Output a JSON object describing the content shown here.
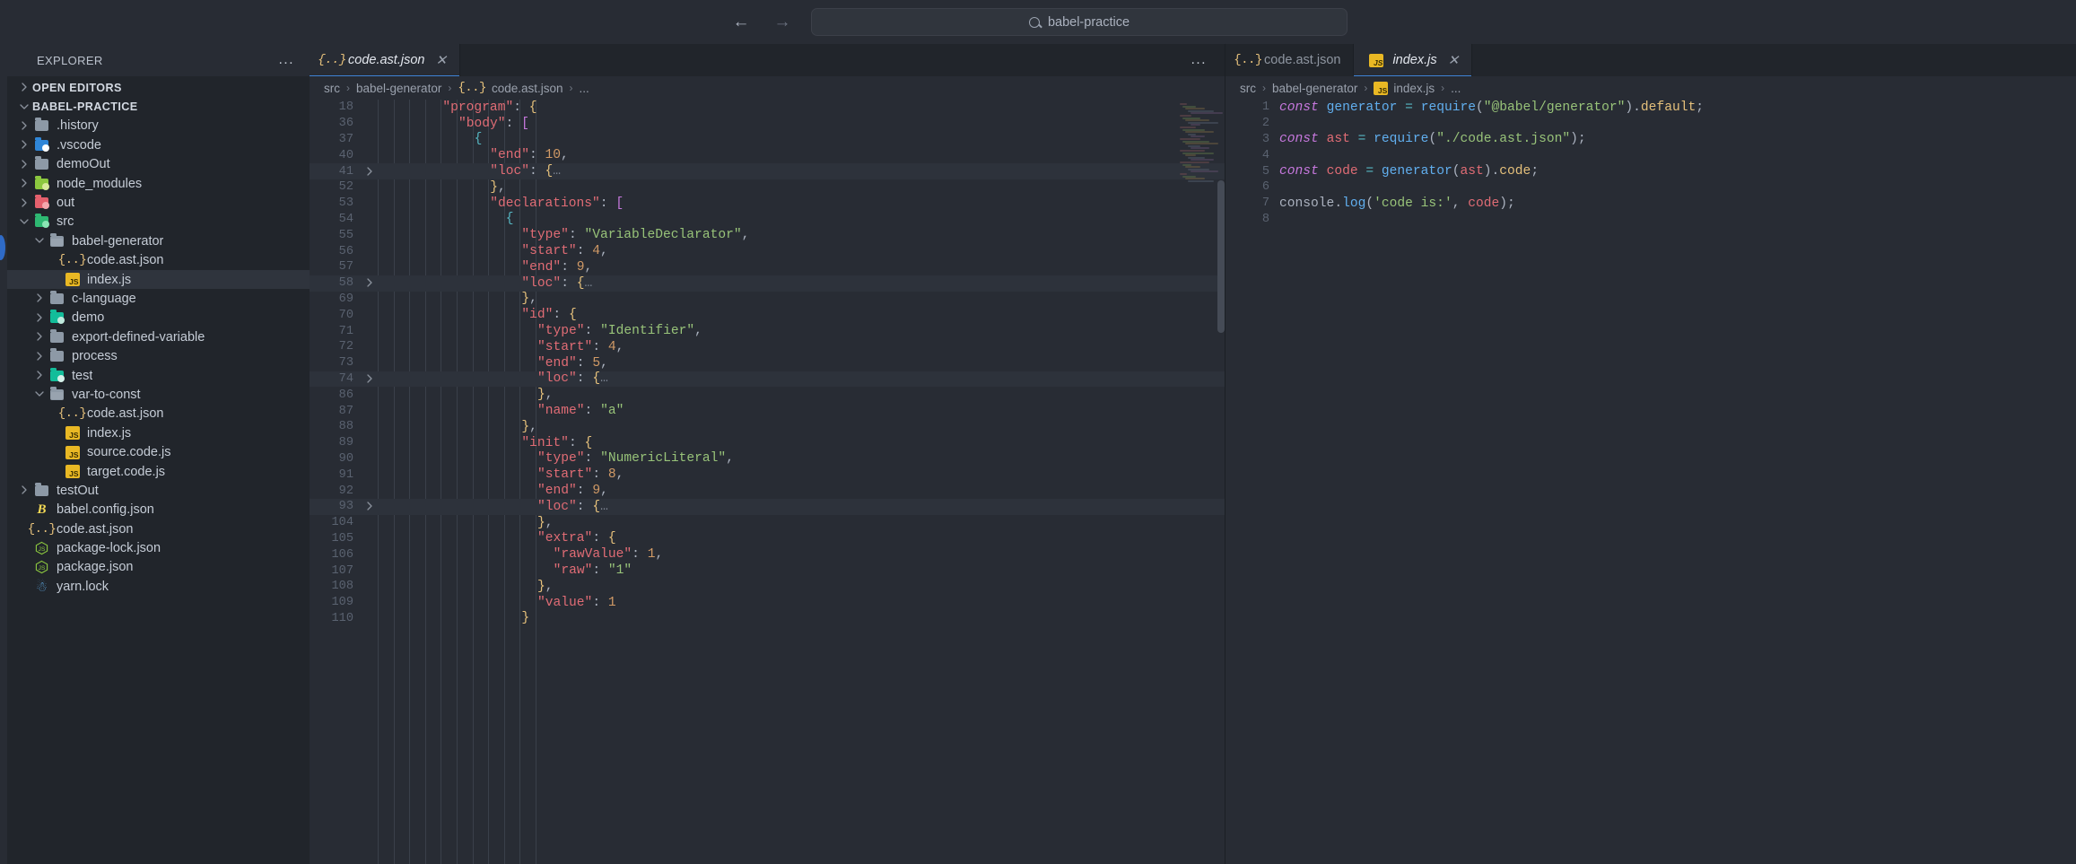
{
  "titlebar": {
    "back_icon": "arrow-left-icon",
    "forward_icon": "arrow-right-icon",
    "search_icon": "search-icon",
    "search_value": "babel-practice"
  },
  "sidebar": {
    "title": "EXPLORER",
    "more_label": "...",
    "sections": [
      {
        "label": "OPEN EDITORS",
        "expanded": false
      },
      {
        "label": "BABEL-PRACTICE",
        "expanded": true
      }
    ],
    "items": [
      {
        "label": ".history",
        "depth": 1,
        "type": "folder",
        "arrow": "collapsed",
        "color": "#8d99a6"
      },
      {
        "label": ".vscode",
        "depth": 1,
        "type": "folder",
        "arrow": "collapsed",
        "color": "#2f86d8",
        "badge": "#ffffff"
      },
      {
        "label": "demoOut",
        "depth": 1,
        "type": "folder",
        "arrow": "collapsed",
        "color": "#8d99a6"
      },
      {
        "label": "node_modules",
        "depth": 1,
        "type": "folder",
        "arrow": "collapsed",
        "color": "#8cc83f",
        "badge": "#d7ea9a"
      },
      {
        "label": "out",
        "depth": 1,
        "type": "folder",
        "arrow": "collapsed",
        "color": "#e4606d",
        "badge": "#f4a7ad"
      },
      {
        "label": "src",
        "depth": 1,
        "type": "folder",
        "arrow": "expanded",
        "color": "#2eb872",
        "badge": "#8ae6b4"
      },
      {
        "label": "babel-generator",
        "depth": 2,
        "type": "folderopen",
        "arrow": "expanded",
        "color": "#8d99a6"
      },
      {
        "label": "code.ast.json",
        "depth": 3,
        "type": "json",
        "arrow": "none"
      },
      {
        "label": "index.js",
        "depth": 3,
        "type": "js",
        "arrow": "none",
        "selected": true
      },
      {
        "label": "c-language",
        "depth": 2,
        "type": "folder",
        "arrow": "collapsed",
        "color": "#8d99a6"
      },
      {
        "label": "demo",
        "depth": 2,
        "type": "folder",
        "arrow": "collapsed",
        "color": "#13bd9a",
        "badge": "#bfe9dd"
      },
      {
        "label": "export-defined-variable",
        "depth": 2,
        "type": "folder",
        "arrow": "collapsed",
        "color": "#8d99a6"
      },
      {
        "label": "process",
        "depth": 2,
        "type": "folder",
        "arrow": "collapsed",
        "color": "#8d99a6"
      },
      {
        "label": "test",
        "depth": 2,
        "type": "folder",
        "arrow": "collapsed",
        "color": "#13bd9a",
        "badge": "#d6f2ea"
      },
      {
        "label": "var-to-const",
        "depth": 2,
        "type": "folderopen",
        "arrow": "expanded",
        "color": "#8d99a6"
      },
      {
        "label": "code.ast.json",
        "depth": 3,
        "type": "json",
        "arrow": "none"
      },
      {
        "label": "index.js",
        "depth": 3,
        "type": "js",
        "arrow": "none"
      },
      {
        "label": "source.code.js",
        "depth": 3,
        "type": "js",
        "arrow": "none"
      },
      {
        "label": "target.code.js",
        "depth": 3,
        "type": "js",
        "arrow": "none"
      },
      {
        "label": "testOut",
        "depth": 1,
        "type": "folder",
        "arrow": "collapsed",
        "color": "#8d99a6"
      },
      {
        "label": "babel.config.json",
        "depth": 1,
        "type": "babel",
        "arrow": "none"
      },
      {
        "label": "code.ast.json",
        "depth": 1,
        "type": "json",
        "arrow": "none"
      },
      {
        "label": "package-lock.json",
        "depth": 1,
        "type": "node",
        "arrow": "none"
      },
      {
        "label": "package.json",
        "depth": 1,
        "type": "node",
        "arrow": "none"
      },
      {
        "label": "yarn.lock",
        "depth": 1,
        "type": "yarn",
        "arrow": "none"
      }
    ]
  },
  "left_group": {
    "more_label": "...",
    "tabs": [
      {
        "label": "code.ast.json",
        "icon": "json-icon",
        "active": true,
        "close_icon": "close-icon"
      }
    ],
    "breadcrumb": [
      "src",
      "babel-generator",
      "code.ast.json",
      "..."
    ],
    "lines": [
      {
        "n": "18",
        "fold": "",
        "indent": 4,
        "tokens": [
          {
            "t": "key",
            "v": "\"program\""
          },
          {
            "t": "punc",
            "v": ": "
          },
          {
            "t": "brace",
            "v": "{"
          }
        ]
      },
      {
        "n": "36",
        "fold": "",
        "indent": 5,
        "tokens": [
          {
            "t": "key",
            "v": "\"body\""
          },
          {
            "t": "punc",
            "v": ": "
          },
          {
            "t": "brack",
            "v": "["
          }
        ]
      },
      {
        "n": "37",
        "fold": "",
        "indent": 6,
        "tokens": [
          {
            "t": "cy",
            "v": "{"
          }
        ]
      },
      {
        "n": "40",
        "fold": "",
        "indent": 7,
        "tokens": [
          {
            "t": "key",
            "v": "\"end\""
          },
          {
            "t": "punc",
            "v": ": "
          },
          {
            "t": "num",
            "v": "10"
          },
          {
            "t": "punc",
            "v": ","
          }
        ]
      },
      {
        "n": "41",
        "fold": ">",
        "hl": true,
        "indent": 7,
        "tokens": [
          {
            "t": "key",
            "v": "\"loc\""
          },
          {
            "t": "punc",
            "v": ": "
          },
          {
            "t": "brace",
            "v": "{"
          },
          {
            "t": "fold",
            "v": "…"
          }
        ]
      },
      {
        "n": "52",
        "fold": "",
        "indent": 7,
        "tokens": [
          {
            "t": "brace",
            "v": "}"
          },
          {
            "t": "punc",
            "v": ","
          }
        ]
      },
      {
        "n": "53",
        "fold": "",
        "indent": 7,
        "tokens": [
          {
            "t": "key",
            "v": "\"declarations\""
          },
          {
            "t": "punc",
            "v": ": "
          },
          {
            "t": "brack",
            "v": "["
          }
        ]
      },
      {
        "n": "54",
        "fold": "",
        "indent": 8,
        "tokens": [
          {
            "t": "cy",
            "v": "{"
          }
        ]
      },
      {
        "n": "55",
        "fold": "",
        "indent": 9,
        "tokens": [
          {
            "t": "key",
            "v": "\"type\""
          },
          {
            "t": "punc",
            "v": ": "
          },
          {
            "t": "str",
            "v": "\"VariableDeclarator\""
          },
          {
            "t": "punc",
            "v": ","
          }
        ]
      },
      {
        "n": "56",
        "fold": "",
        "indent": 9,
        "tokens": [
          {
            "t": "key",
            "v": "\"start\""
          },
          {
            "t": "punc",
            "v": ": "
          },
          {
            "t": "num",
            "v": "4"
          },
          {
            "t": "punc",
            "v": ","
          }
        ]
      },
      {
        "n": "57",
        "fold": "",
        "indent": 9,
        "tokens": [
          {
            "t": "key",
            "v": "\"end\""
          },
          {
            "t": "punc",
            "v": ": "
          },
          {
            "t": "num",
            "v": "9"
          },
          {
            "t": "punc",
            "v": ","
          }
        ]
      },
      {
        "n": "58",
        "fold": ">",
        "hl": true,
        "indent": 9,
        "tokens": [
          {
            "t": "key",
            "v": "\"loc\""
          },
          {
            "t": "punc",
            "v": ": "
          },
          {
            "t": "brace",
            "v": "{"
          },
          {
            "t": "fold",
            "v": "…"
          }
        ]
      },
      {
        "n": "69",
        "fold": "",
        "indent": 9,
        "tokens": [
          {
            "t": "brace",
            "v": "}"
          },
          {
            "t": "punc",
            "v": ","
          }
        ]
      },
      {
        "n": "70",
        "fold": "",
        "indent": 9,
        "tokens": [
          {
            "t": "key",
            "v": "\"id\""
          },
          {
            "t": "punc",
            "v": ": "
          },
          {
            "t": "brace",
            "v": "{"
          }
        ]
      },
      {
        "n": "71",
        "fold": "",
        "indent": 10,
        "tokens": [
          {
            "t": "key",
            "v": "\"type\""
          },
          {
            "t": "punc",
            "v": ": "
          },
          {
            "t": "str",
            "v": "\"Identifier\""
          },
          {
            "t": "punc",
            "v": ","
          }
        ]
      },
      {
        "n": "72",
        "fold": "",
        "indent": 10,
        "tokens": [
          {
            "t": "key",
            "v": "\"start\""
          },
          {
            "t": "punc",
            "v": ": "
          },
          {
            "t": "num",
            "v": "4"
          },
          {
            "t": "punc",
            "v": ","
          }
        ]
      },
      {
        "n": "73",
        "fold": "",
        "indent": 10,
        "tokens": [
          {
            "t": "key",
            "v": "\"end\""
          },
          {
            "t": "punc",
            "v": ": "
          },
          {
            "t": "num",
            "v": "5"
          },
          {
            "t": "punc",
            "v": ","
          }
        ]
      },
      {
        "n": "74",
        "fold": ">",
        "hl": true,
        "indent": 10,
        "tokens": [
          {
            "t": "key",
            "v": "\"loc\""
          },
          {
            "t": "punc",
            "v": ": "
          },
          {
            "t": "brace",
            "v": "{"
          },
          {
            "t": "fold",
            "v": "…"
          }
        ]
      },
      {
        "n": "86",
        "fold": "",
        "indent": 10,
        "tokens": [
          {
            "t": "brace",
            "v": "}"
          },
          {
            "t": "punc",
            "v": ","
          }
        ]
      },
      {
        "n": "87",
        "fold": "",
        "indent": 10,
        "tokens": [
          {
            "t": "key",
            "v": "\"name\""
          },
          {
            "t": "punc",
            "v": ": "
          },
          {
            "t": "str",
            "v": "\"a\""
          }
        ]
      },
      {
        "n": "88",
        "fold": "",
        "indent": 9,
        "tokens": [
          {
            "t": "brace",
            "v": "}"
          },
          {
            "t": "punc",
            "v": ","
          }
        ]
      },
      {
        "n": "89",
        "fold": "",
        "indent": 9,
        "tokens": [
          {
            "t": "key",
            "v": "\"init\""
          },
          {
            "t": "punc",
            "v": ": "
          },
          {
            "t": "brace",
            "v": "{"
          }
        ]
      },
      {
        "n": "90",
        "fold": "",
        "indent": 10,
        "tokens": [
          {
            "t": "key",
            "v": "\"type\""
          },
          {
            "t": "punc",
            "v": ": "
          },
          {
            "t": "str",
            "v": "\"NumericLiteral\""
          },
          {
            "t": "punc",
            "v": ","
          }
        ]
      },
      {
        "n": "91",
        "fold": "",
        "indent": 10,
        "tokens": [
          {
            "t": "key",
            "v": "\"start\""
          },
          {
            "t": "punc",
            "v": ": "
          },
          {
            "t": "num",
            "v": "8"
          },
          {
            "t": "punc",
            "v": ","
          }
        ]
      },
      {
        "n": "92",
        "fold": "",
        "indent": 10,
        "tokens": [
          {
            "t": "key",
            "v": "\"end\""
          },
          {
            "t": "punc",
            "v": ": "
          },
          {
            "t": "num",
            "v": "9"
          },
          {
            "t": "punc",
            "v": ","
          }
        ]
      },
      {
        "n": "93",
        "fold": ">",
        "hl": true,
        "indent": 10,
        "tokens": [
          {
            "t": "key",
            "v": "\"loc\""
          },
          {
            "t": "punc",
            "v": ": "
          },
          {
            "t": "brace",
            "v": "{"
          },
          {
            "t": "fold",
            "v": "…"
          }
        ]
      },
      {
        "n": "104",
        "fold": "",
        "indent": 10,
        "tokens": [
          {
            "t": "brace",
            "v": "}"
          },
          {
            "t": "punc",
            "v": ","
          }
        ]
      },
      {
        "n": "105",
        "fold": "",
        "indent": 10,
        "tokens": [
          {
            "t": "key",
            "v": "\"extra\""
          },
          {
            "t": "punc",
            "v": ": "
          },
          {
            "t": "brace",
            "v": "{"
          }
        ]
      },
      {
        "n": "106",
        "fold": "",
        "indent": 11,
        "tokens": [
          {
            "t": "key",
            "v": "\"rawValue\""
          },
          {
            "t": "punc",
            "v": ": "
          },
          {
            "t": "num",
            "v": "1"
          },
          {
            "t": "punc",
            "v": ","
          }
        ]
      },
      {
        "n": "107",
        "fold": "",
        "indent": 11,
        "tokens": [
          {
            "t": "key",
            "v": "\"raw\""
          },
          {
            "t": "punc",
            "v": ": "
          },
          {
            "t": "str",
            "v": "\"1\""
          }
        ]
      },
      {
        "n": "108",
        "fold": "",
        "indent": 10,
        "tokens": [
          {
            "t": "brace",
            "v": "}"
          },
          {
            "t": "punc",
            "v": ","
          }
        ]
      },
      {
        "n": "109",
        "fold": "",
        "indent": 10,
        "tokens": [
          {
            "t": "key",
            "v": "\"value\""
          },
          {
            "t": "punc",
            "v": ": "
          },
          {
            "t": "num",
            "v": "1"
          }
        ]
      },
      {
        "n": "110",
        "fold": "",
        "indent": 9,
        "tokens": [
          {
            "t": "brace",
            "v": "}"
          }
        ]
      }
    ]
  },
  "right_group": {
    "tabs": [
      {
        "label": "code.ast.json",
        "icon": "json-icon",
        "active": false
      },
      {
        "label": "index.js",
        "icon": "js-icon",
        "active": true,
        "close_icon": "close-icon"
      }
    ],
    "breadcrumb": [
      "src",
      "babel-generator",
      "index.js",
      "..."
    ],
    "lines": [
      {
        "n": "1",
        "tokens": [
          {
            "t": "kw",
            "v": "const"
          },
          {
            "t": "plain",
            "v": " "
          },
          {
            "t": "fn",
            "v": "generator"
          },
          {
            "t": "plain",
            "v": " "
          },
          {
            "t": "cy",
            "v": "="
          },
          {
            "t": "plain",
            "v": " "
          },
          {
            "t": "fn",
            "v": "require"
          },
          {
            "t": "punc",
            "v": "("
          },
          {
            "t": "str",
            "v": "\"@babel/generator\""
          },
          {
            "t": "punc",
            "v": ")."
          },
          {
            "t": "prop",
            "v": "default"
          },
          {
            "t": "punc",
            "v": ";"
          }
        ]
      },
      {
        "n": "2",
        "tokens": []
      },
      {
        "n": "3",
        "tokens": [
          {
            "t": "kw",
            "v": "const"
          },
          {
            "t": "plain",
            "v": " "
          },
          {
            "t": "var",
            "v": "ast"
          },
          {
            "t": "plain",
            "v": " "
          },
          {
            "t": "cy",
            "v": "="
          },
          {
            "t": "plain",
            "v": " "
          },
          {
            "t": "fn",
            "v": "require"
          },
          {
            "t": "punc",
            "v": "("
          },
          {
            "t": "str",
            "v": "\"./code.ast.json\""
          },
          {
            "t": "punc",
            "v": ");"
          }
        ]
      },
      {
        "n": "4",
        "tokens": []
      },
      {
        "n": "5",
        "tokens": [
          {
            "t": "kw",
            "v": "const"
          },
          {
            "t": "plain",
            "v": " "
          },
          {
            "t": "var",
            "v": "code"
          },
          {
            "t": "plain",
            "v": " "
          },
          {
            "t": "cy",
            "v": "="
          },
          {
            "t": "plain",
            "v": " "
          },
          {
            "t": "fn",
            "v": "generator"
          },
          {
            "t": "punc",
            "v": "("
          },
          {
            "t": "var",
            "v": "ast"
          },
          {
            "t": "punc",
            "v": ")."
          },
          {
            "t": "prop",
            "v": "code"
          },
          {
            "t": "punc",
            "v": ";"
          }
        ]
      },
      {
        "n": "6",
        "tokens": []
      },
      {
        "n": "7",
        "tokens": [
          {
            "t": "plain",
            "v": "console"
          },
          {
            "t": "punc",
            "v": "."
          },
          {
            "t": "fn",
            "v": "log"
          },
          {
            "t": "punc",
            "v": "("
          },
          {
            "t": "str",
            "v": "'code is:'"
          },
          {
            "t": "punc",
            "v": ", "
          },
          {
            "t": "var",
            "v": "code"
          },
          {
            "t": "punc",
            "v": ");"
          }
        ]
      },
      {
        "n": "8",
        "tokens": [],
        "cursor": true
      }
    ]
  }
}
